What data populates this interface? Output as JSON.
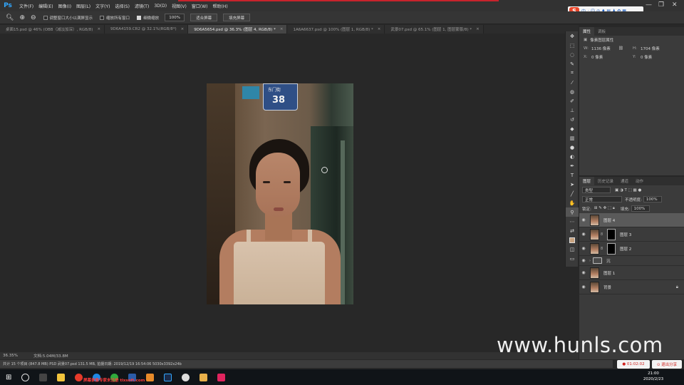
{
  "app": {
    "logo": "Ps"
  },
  "menu": [
    "文件(F)",
    "编辑(E)",
    "图像(I)",
    "图层(L)",
    "文字(Y)",
    "选择(S)",
    "滤镜(T)",
    "3D(D)",
    "视图(V)",
    "窗口(W)",
    "帮助(H)"
  ],
  "ime": {
    "label": "中",
    "glyphs": "· ☺ ◎ ♦ ▤ ♟ ✿ ▦"
  },
  "window_controls": {
    "minimize": "—",
    "restore": "❐",
    "close": "✕"
  },
  "options_bar": {
    "tool_icon": "zoom-icon",
    "resize_windows": "调整窗口大小以满屏显示",
    "zoom_all": "缩放所有窗口",
    "scrubby_zoom": "细微缩放",
    "zoom_value": "100%",
    "fit_screen": "适合屏幕",
    "fill_screen": "填充屏幕"
  },
  "tabs": [
    {
      "label": "桌面15.psd @ 46% (OBB（减淡加深）, RGB/8)",
      "active": false
    },
    {
      "label": "9D6A4159.CR2 @ 32.1%(RGB/8*)",
      "active": false
    },
    {
      "label": "9D6A5654.psd @ 36.3% (图层 4, RGB/8) *",
      "active": true
    },
    {
      "label": "1A6A6637.psd @ 100% (图层 1, RGB/8) *",
      "active": false
    },
    {
      "label": "武景07.psd @ 65.1% (图层 1, 图层蒙版/8) *",
      "active": false
    }
  ],
  "photo": {
    "sign_text": "东门街",
    "sign_number": "38"
  },
  "status": {
    "zoom": "36.35%",
    "doc": "文档:5.04M/33.8M"
  },
  "ppt_bar": {
    "items": "共计 15 个项目 (847.8 MB)   PSD 武景07.psd   131.5 MB, 拍摄日期: 2019/12/19 16:54:06   5030x3392x24b"
  },
  "properties": {
    "tabs": [
      "属性",
      "调板"
    ],
    "header": "像素图层属性",
    "w_label": "W:",
    "w_value": "1136 像素",
    "h_label": "H:",
    "h_value": "1704 像素",
    "x_label": "X:",
    "x_value": "0 像素",
    "y_label": "Y:",
    "y_value": "0 像素"
  },
  "layers_panel": {
    "tabs": [
      "图层",
      "历史记录",
      "通道",
      "动作"
    ],
    "filter": "类型",
    "blend": "正常",
    "opacity_label": "不透明度:",
    "opacity": "100%",
    "lock_label": "锁定:",
    "fill_label": "填充:",
    "fill": "100%",
    "layers": [
      {
        "name": "图层 4",
        "mask": false,
        "selected": true,
        "group": false,
        "lock": false
      },
      {
        "name": "图层 3",
        "mask": true,
        "selected": false,
        "group": false,
        "lock": false
      },
      {
        "name": "图层 2",
        "mask": true,
        "selected": false,
        "group": false,
        "lock": false
      },
      {
        "name": "沉",
        "mask": false,
        "selected": false,
        "group": true,
        "lock": false
      },
      {
        "name": "图层 1",
        "mask": false,
        "selected": false,
        "group": false,
        "lock": false
      },
      {
        "name": "背景",
        "mask": false,
        "selected": false,
        "group": false,
        "lock": true
      }
    ]
  },
  "watermark": "www.hunls.com",
  "recording": {
    "time": "● 01:02:02",
    "share": "⊙ 退出分享"
  },
  "taskbar": {
    "red_text": "屏幕录像专家未注册 tlxsoft.com",
    "time": "21:00",
    "date": "2020/2/23"
  }
}
